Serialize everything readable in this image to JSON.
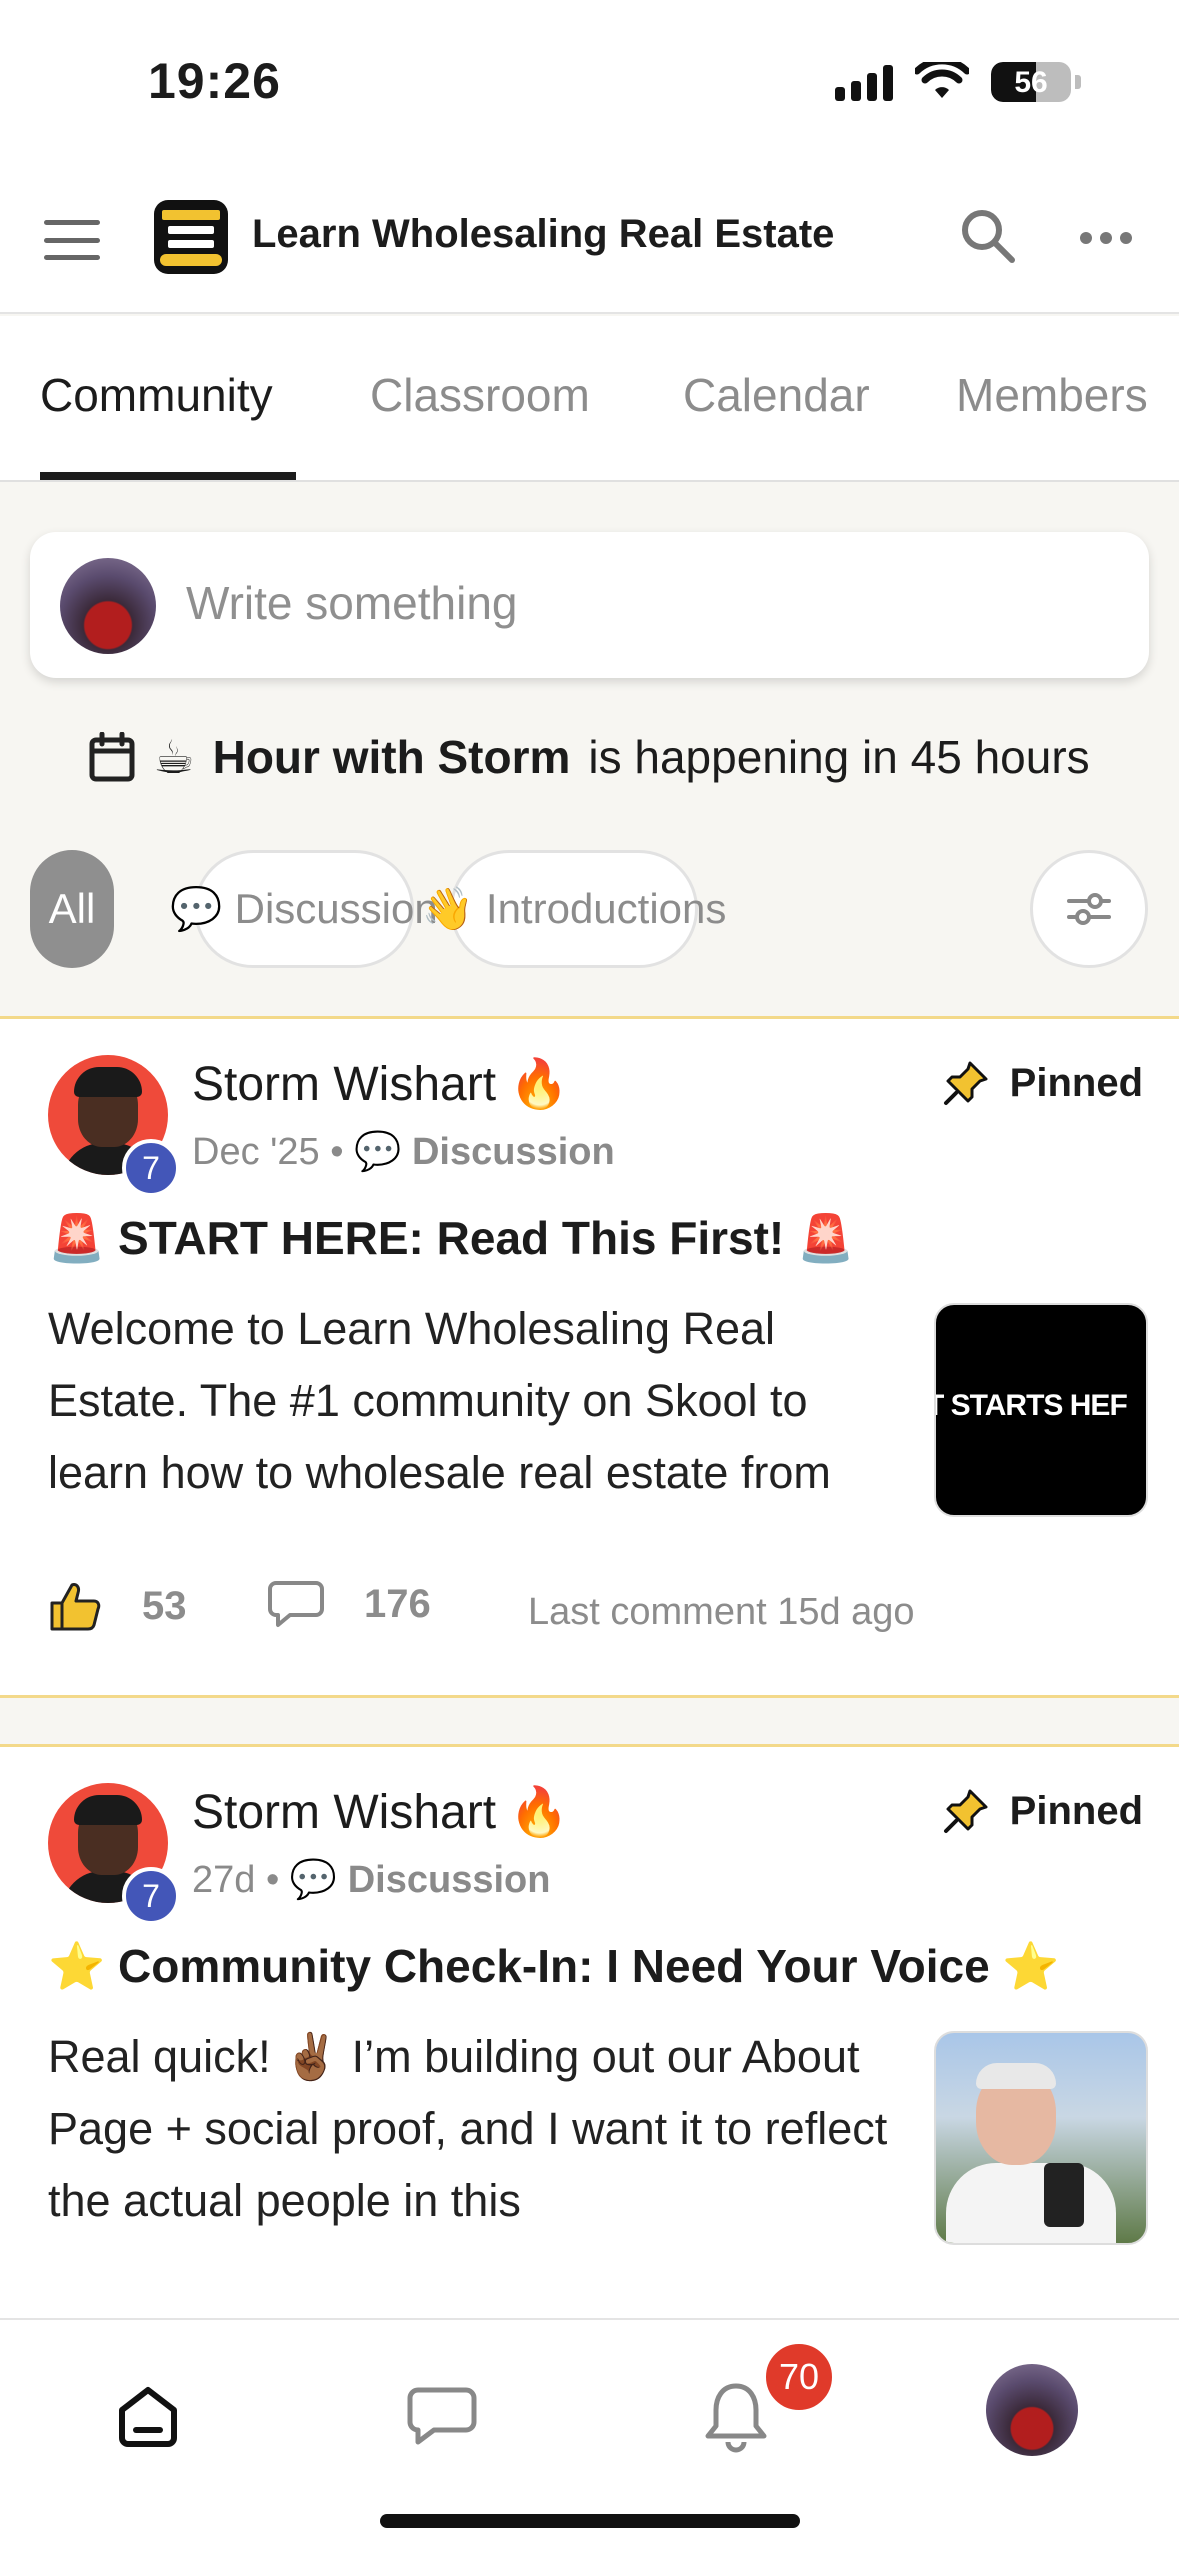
{
  "status_bar": {
    "time": "19:26",
    "battery": "56",
    "battery_fraction": 0.56
  },
  "header": {
    "group_title": "Learn Wholesaling Real Estate",
    "logo_icon": "group-logo"
  },
  "tabs": [
    {
      "label": "Community",
      "active": true
    },
    {
      "label": "Classroom",
      "active": false
    },
    {
      "label": "Calendar",
      "active": false
    },
    {
      "label": "Members",
      "active": false
    }
  ],
  "composer": {
    "placeholder": "Write something"
  },
  "event": {
    "emoji": "☕",
    "name": "Hour with Storm",
    "suffix": "is happening in 45 hours"
  },
  "filters": [
    {
      "label": "All",
      "emoji": "",
      "active": true
    },
    {
      "label": "Discussion",
      "emoji": "💬",
      "active": false
    },
    {
      "label": "Introductions",
      "emoji": "👋",
      "active": false
    }
  ],
  "posts": [
    {
      "author": "Storm Wishart",
      "author_emoji": "🔥",
      "level": "7",
      "date": "Dec '25",
      "category": "Discussion",
      "category_emoji": "💬",
      "pinned_label": "Pinned",
      "title": "🚨 START HERE: Read This First! 🚨",
      "body": "Welcome to Learn Wholesaling Real Estate. The #1 community on Skool to learn how to wholesale real estate from",
      "thumbnail_text": "T STARTS HEF",
      "likes": "53",
      "comments": "176",
      "last_comment": "Last comment 15d ago"
    },
    {
      "author": "Storm Wishart",
      "author_emoji": "🔥",
      "level": "7",
      "date": "27d",
      "category": "Discussion",
      "category_emoji": "💬",
      "pinned_label": "Pinned",
      "title": "⭐ Community Check-In: I Need Your Voice ⭐",
      "body": "Real quick! ✌🏾 I’m building out our About Page + social proof, and I want it to reflect the actual people in this"
    }
  ],
  "bottom_nav": {
    "notifications_count": "70"
  },
  "colors": {
    "accent_pinned_border": "#f3d98a",
    "level_badge": "#4356b8",
    "notification_badge": "#e03a2a"
  }
}
